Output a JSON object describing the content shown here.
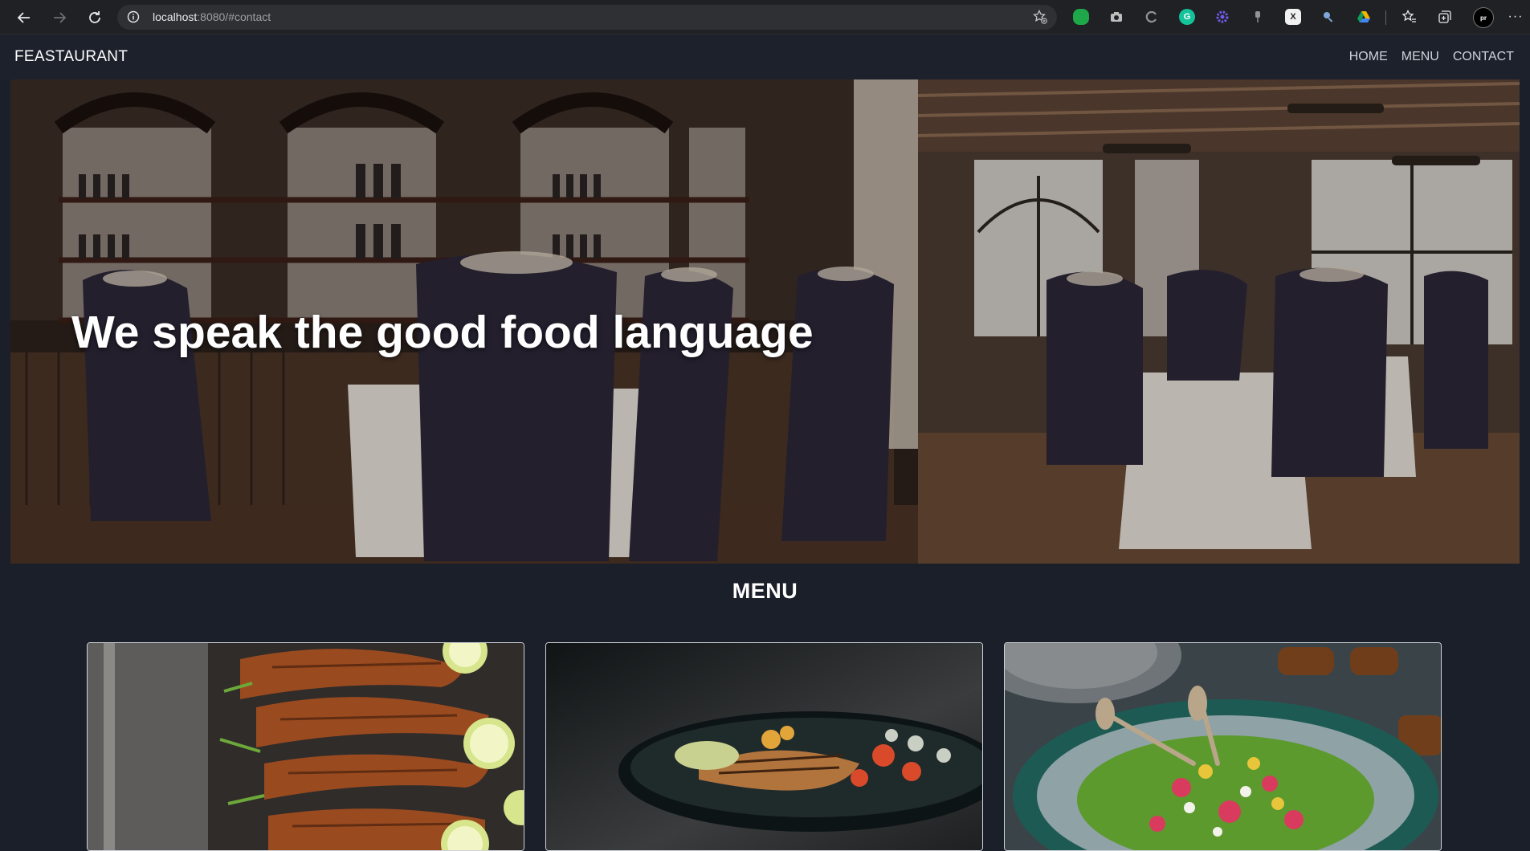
{
  "browser": {
    "url_host": "localhost",
    "url_rest": ":8080/#contact",
    "extensions": [
      "evernote-icon",
      "camera-icon",
      "grammarly-c-icon",
      "grammarly-icon",
      "gear-extension-icon",
      "pin-icon",
      "x-extension-icon",
      "search-extension-icon",
      "drive-icon"
    ],
    "profile_label": "pr"
  },
  "site": {
    "brand": "FEASTAURANT",
    "nav": [
      "HOME",
      "MENU",
      "CONTACT"
    ],
    "hero_title": "We speak the good food language",
    "menu_heading": "MENU"
  },
  "menu_cards": [
    {
      "image": "grilled-fish-with-lime"
    },
    {
      "image": "grilled-salmon-plate"
    },
    {
      "image": "salad-bowl"
    }
  ]
}
